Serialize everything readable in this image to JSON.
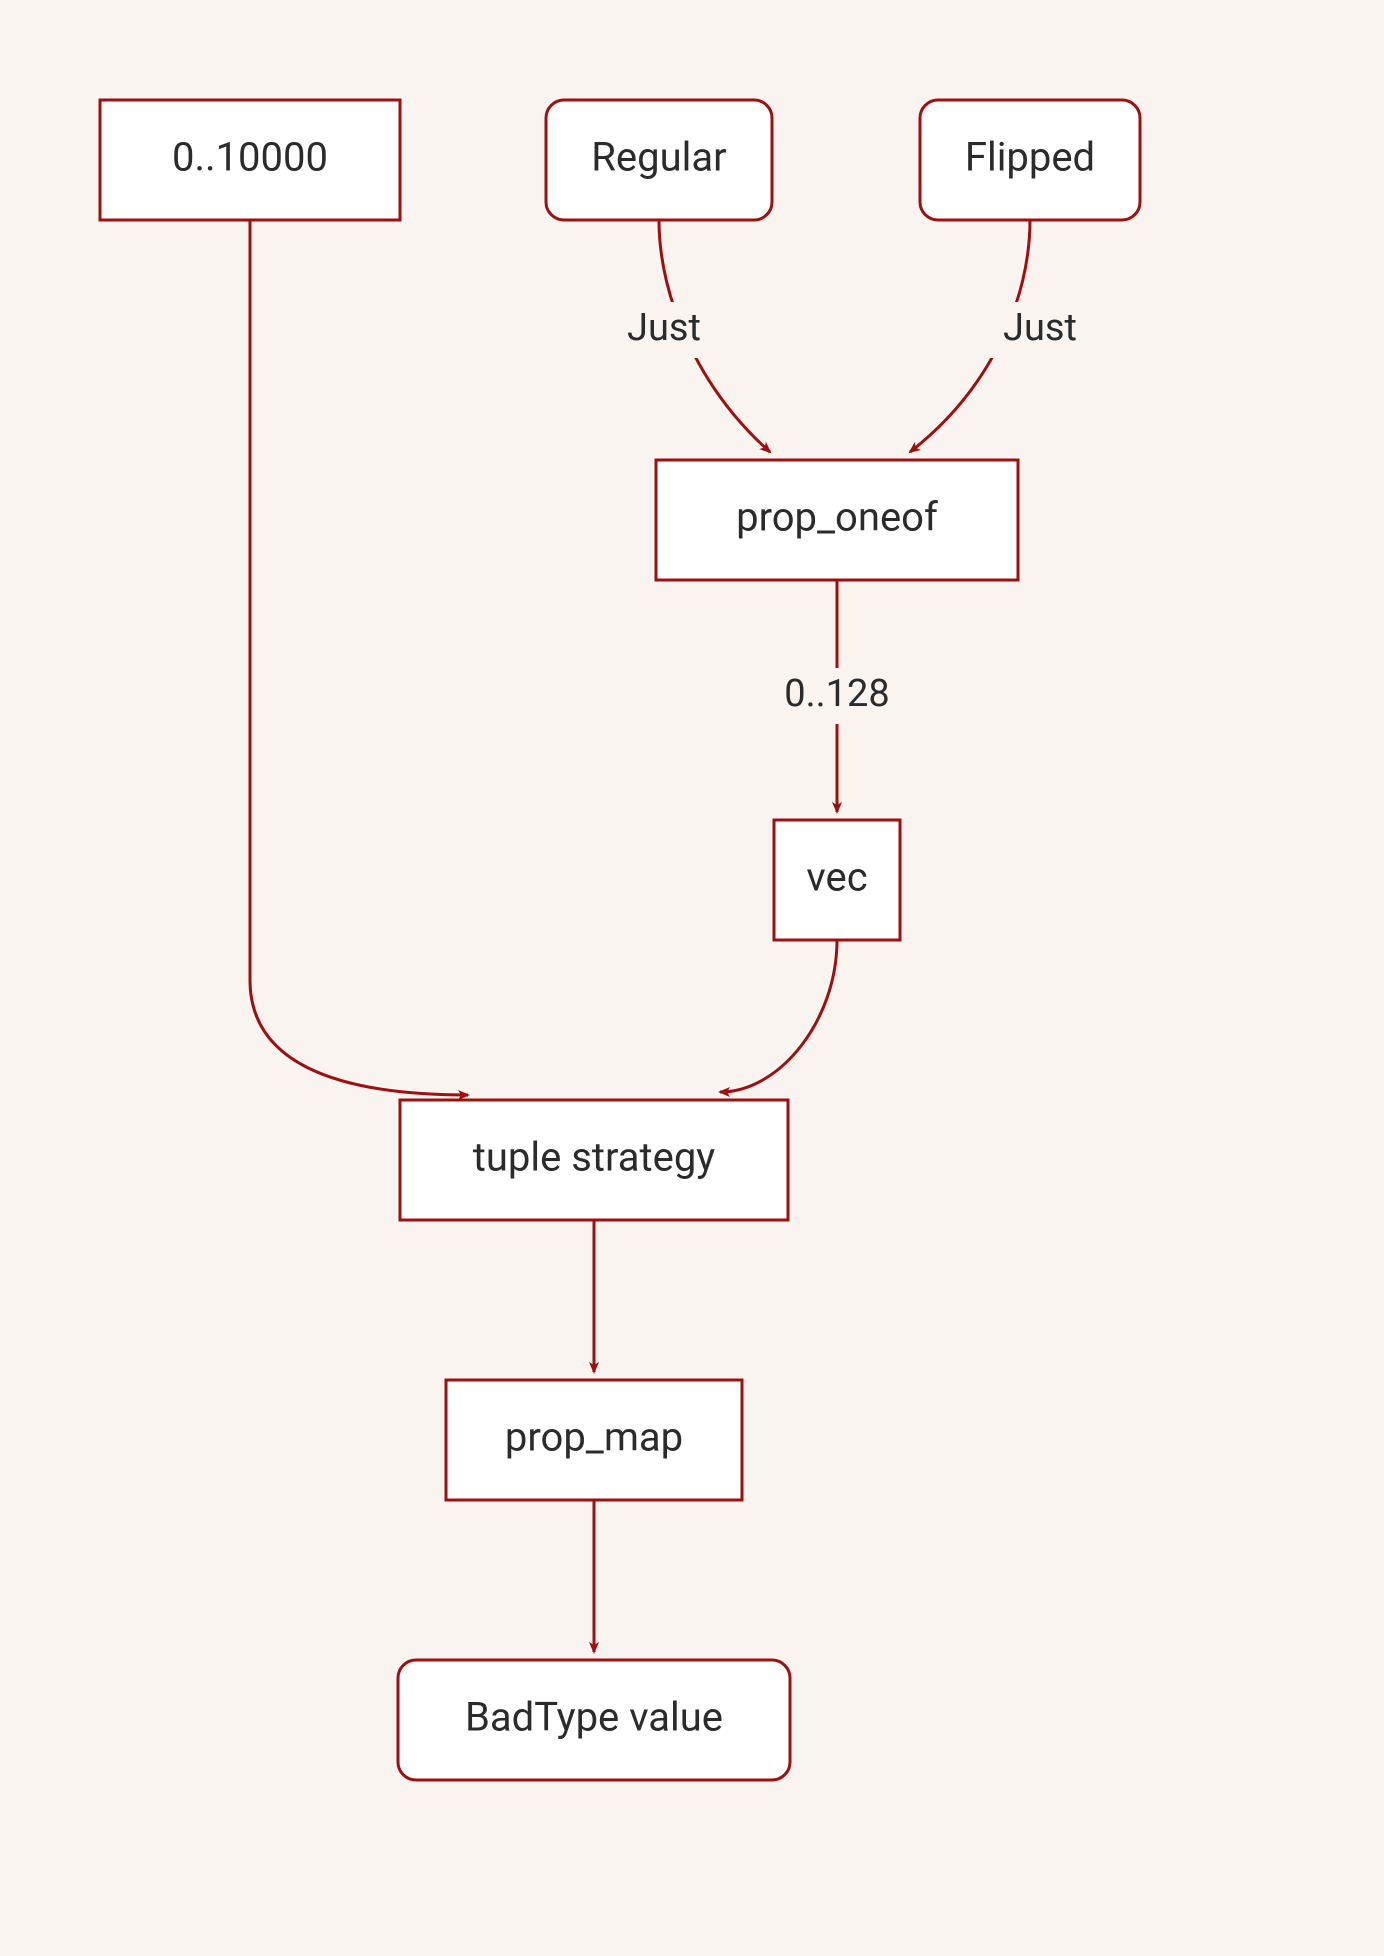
{
  "nodes": {
    "range": "0..10000",
    "regular": "Regular",
    "flipped": "Flipped",
    "prop_oneof": "prop_oneof",
    "vec": "vec",
    "tuple": "tuple strategy",
    "prop_map": "prop_map",
    "badtype": "BadType value"
  },
  "edge_labels": {
    "regular_to_oneof": "Just",
    "flipped_to_oneof": "Just",
    "oneof_to_vec": "0..128"
  },
  "colors": {
    "stroke": "#a00f0f",
    "bg": "#f9f4f0",
    "node_fill": "#ffffff",
    "text": "#2b2b2b"
  }
}
